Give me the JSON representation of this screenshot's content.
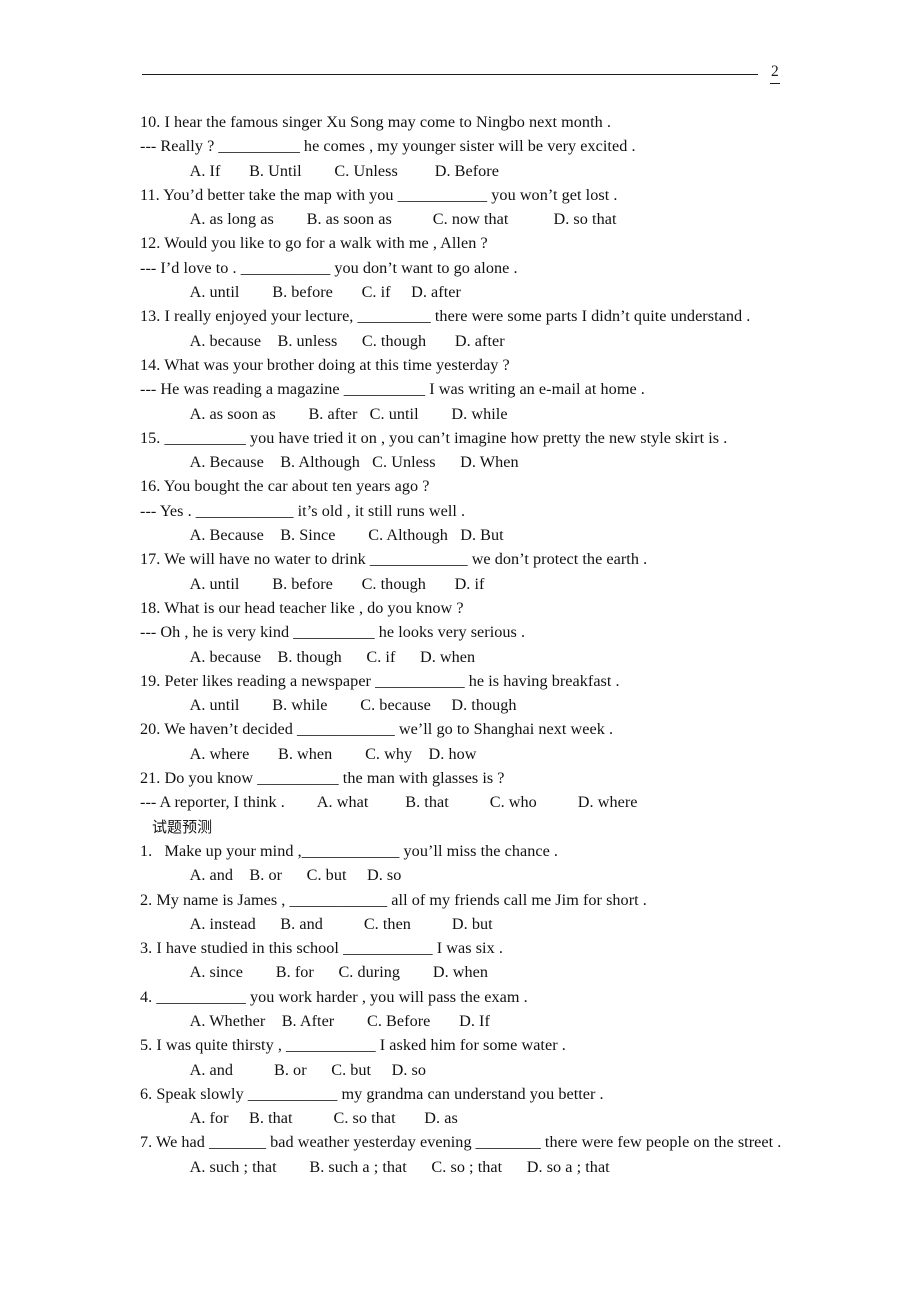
{
  "header": {
    "page_number": "2"
  },
  "section_heading": "试题预测",
  "questions_part1": [
    {
      "stem": "10. I hear the famous singer Xu Song may come to Ningbo next month .",
      "reply": "--- Really ? __________ he comes , my younger sister will be very excited .",
      "options": "     A. If       B. Until        C. Unless         D. Before"
    },
    {
      "stem": "11. You’d better take the map with you ___________ you won’t get lost .",
      "reply": "",
      "options": "     A. as long as        B. as soon as          C. now that           D. so that"
    },
    {
      "stem": "12. Would you like to go for a walk with me , Allen ?",
      "reply": "--- I’d love to . ___________ you don’t want to go alone .",
      "options": "     A. until        B. before       C. if     D. after"
    },
    {
      "stem": "13. I really enjoyed your lecture, _________ there were some parts I didn’t quite understand .",
      "reply": "",
      "options": "     A. because    B. unless      C. though       D. after"
    },
    {
      "stem": "14. What was your brother doing at this time yesterday ?",
      "reply": "--- He was reading a magazine __________ I was writing an e-mail at home .",
      "options": "     A. as soon as        B. after   C. until        D. while"
    },
    {
      "stem": "15. __________ you have tried it on , you can’t imagine how pretty the new style skirt is .",
      "reply": "",
      "options": "     A. Because    B. Although   C. Unless      D. When"
    },
    {
      "stem": "16. You bought the car about ten years ago ?",
      "reply": "--- Yes . ____________ it’s old , it still runs well .",
      "options": "     A. Because    B. Since        C. Although   D. But"
    },
    {
      "stem": "17. We will have no water to drink ____________ we don’t protect the earth .",
      "reply": "",
      "options": "     A. until        B. before       C. though       D. if"
    },
    {
      "stem": "18. What is our head teacher like , do you know ?",
      "reply": "--- Oh , he is very kind __________ he looks very serious .",
      "options": "     A. because    B. though      C. if      D. when"
    },
    {
      "stem": "19. Peter likes reading a newspaper ___________ he is having breakfast .",
      "reply": "",
      "options": "     A. until        B. while        C. because     D. though"
    },
    {
      "stem": "20. We haven’t decided ____________ we’ll go to Shanghai next week .",
      "reply": "",
      "options": "     A. where       B. when        C. why    D. how"
    },
    {
      "stem": "21. Do you know __________ the man with glasses is ?",
      "reply": "--- A reporter, I think .        A. what         B. that          C. who          D. where",
      "options": ""
    }
  ],
  "questions_part2": [
    {
      "stem": "1.   Make up your mind ,____________ you’ll miss the chance .",
      "reply": "",
      "options": "     A. and    B. or      C. but     D. so"
    },
    {
      "stem": "2. My name is James , ____________ all of my friends call me Jim for short .",
      "reply": "",
      "options": "     A. instead      B. and          C. then          D. but"
    },
    {
      "stem": "3. I have studied in this school ___________ I was six .",
      "reply": "",
      "options": "     A. since        B. for      C. during        D. when"
    },
    {
      "stem": "4. ___________ you work harder , you will pass the exam .",
      "reply": "",
      "options": "     A. Whether    B. After        C. Before       D. If"
    },
    {
      "stem": "5. I was quite thirsty , ___________ I asked him for some water .",
      "reply": "",
      "options": "     A. and          B. or      C. but     D. so"
    },
    {
      "stem": "6. Speak slowly ___________ my grandma can understand you better .",
      "reply": "",
      "options": "     A. for     B. that          C. so that       D. as"
    },
    {
      "stem": "7. We had _______ bad weather yesterday evening ________ there were few people on the street .",
      "reply": "",
      "options": "     A. such ; that        B. such a ; that      C. so ; that      D. so a ; that"
    }
  ]
}
